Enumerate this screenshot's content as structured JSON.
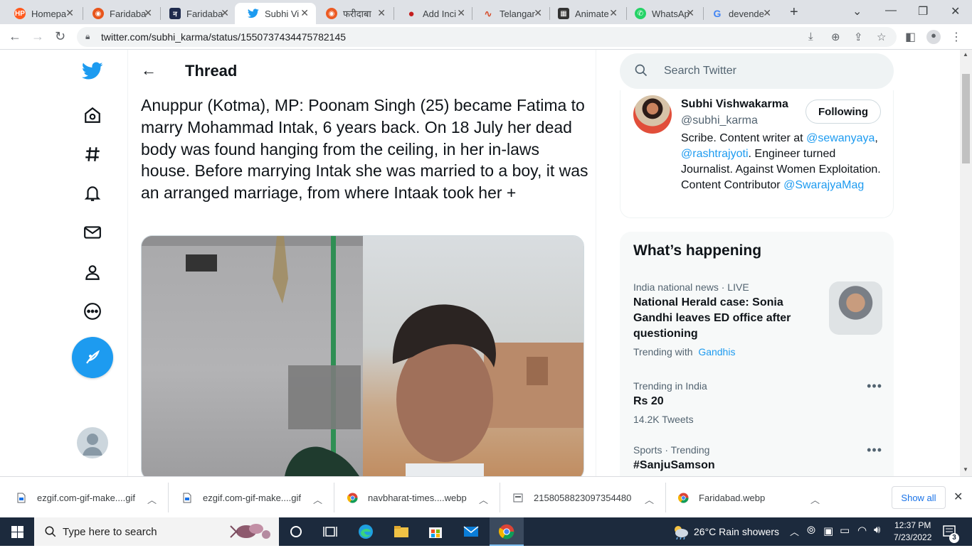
{
  "browser": {
    "tabs": [
      {
        "title": "Homepa",
        "favicon_color": "#ff5a1f"
      },
      {
        "title": "Faridaba",
        "favicon_color": "#e8551c"
      },
      {
        "title": "Faridaba",
        "favicon_color": "#1f2b4d"
      },
      {
        "title": "Subhi Vi",
        "favicon_color": "#1d9bf0",
        "active": true
      },
      {
        "title": "फरीदाबा",
        "favicon_color": "#ec5b24"
      },
      {
        "title": "Add Inci",
        "favicon_color": "#c41e1e"
      },
      {
        "title": "Telangar",
        "favicon_color": "#d64b2a"
      },
      {
        "title": "Animate",
        "favicon_color": "#333333"
      },
      {
        "title": "WhatsAp",
        "favicon_color": "#25d366"
      },
      {
        "title": "devende",
        "favicon_color": "#4285f4"
      }
    ],
    "url": "twitter.com/subhi_karma/status/1550737434475782145"
  },
  "twitter": {
    "brand_color": "#1d9bf0",
    "nav_icons": [
      "twitter-logo",
      "home-icon",
      "explore-icon",
      "notifications-icon",
      "messages-icon",
      "profile-icon",
      "more-icon"
    ],
    "thread_title": "Thread",
    "tweet_text": "Anuppur (Kotma), MP: Poonam Singh (25) became Fatima to marry Mohammad Intak, 6 years back. On 18 July her dead body was found hanging from the ceiling, in her in-laws house. Before marrying Intak she was married to a boy, it was an arranged marriage, from where Intaak took her +",
    "search_placeholder": "Search Twitter",
    "profile": {
      "name": "Subhi Vishwakarma",
      "handle": "@subhi_karma",
      "follow_label": "Following",
      "bio_1": "Scribe. Content writer at ",
      "bio_mention_1": "@sewanyaya",
      "bio_2": ", ",
      "bio_mention_2": "@rashtrajyoti",
      "bio_3": ". Engineer turned Journalist. Against Women Exploitation. Content Contributor ",
      "bio_mention_3": "@SwarajyaMag"
    },
    "happening": {
      "title": "What’s happening",
      "trends": [
        {
          "meta": "India national news · LIVE",
          "name": "National Herald case: Sonia Gandhi leaves ED office after questioning",
          "trending_with_label": "Trending with",
          "trending_with": "Gandhis"
        },
        {
          "meta": "Trending in India",
          "name": "Rs 20",
          "count": "14.2K Tweets"
        },
        {
          "meta": "Sports · Trending",
          "name": "#SanjuSamson"
        }
      ]
    }
  },
  "downloads": {
    "items": [
      {
        "name": "ezgif.com-gif-make....gif",
        "icon": "file-icon"
      },
      {
        "name": "ezgif.com-gif-make....gif",
        "icon": "file-icon"
      },
      {
        "name": "navbharat-times....webp",
        "icon": "chrome-icon"
      },
      {
        "name": "2158058823097354480",
        "icon": "file-icon"
      },
      {
        "name": "Faridabad.webp",
        "icon": "chrome-icon"
      }
    ],
    "show_all": "Show all"
  },
  "taskbar": {
    "search_placeholder": "Type here to search",
    "weather": "26°C  Rain showers",
    "time": "12:37 PM",
    "date": "7/23/2022",
    "notifications": "3"
  }
}
